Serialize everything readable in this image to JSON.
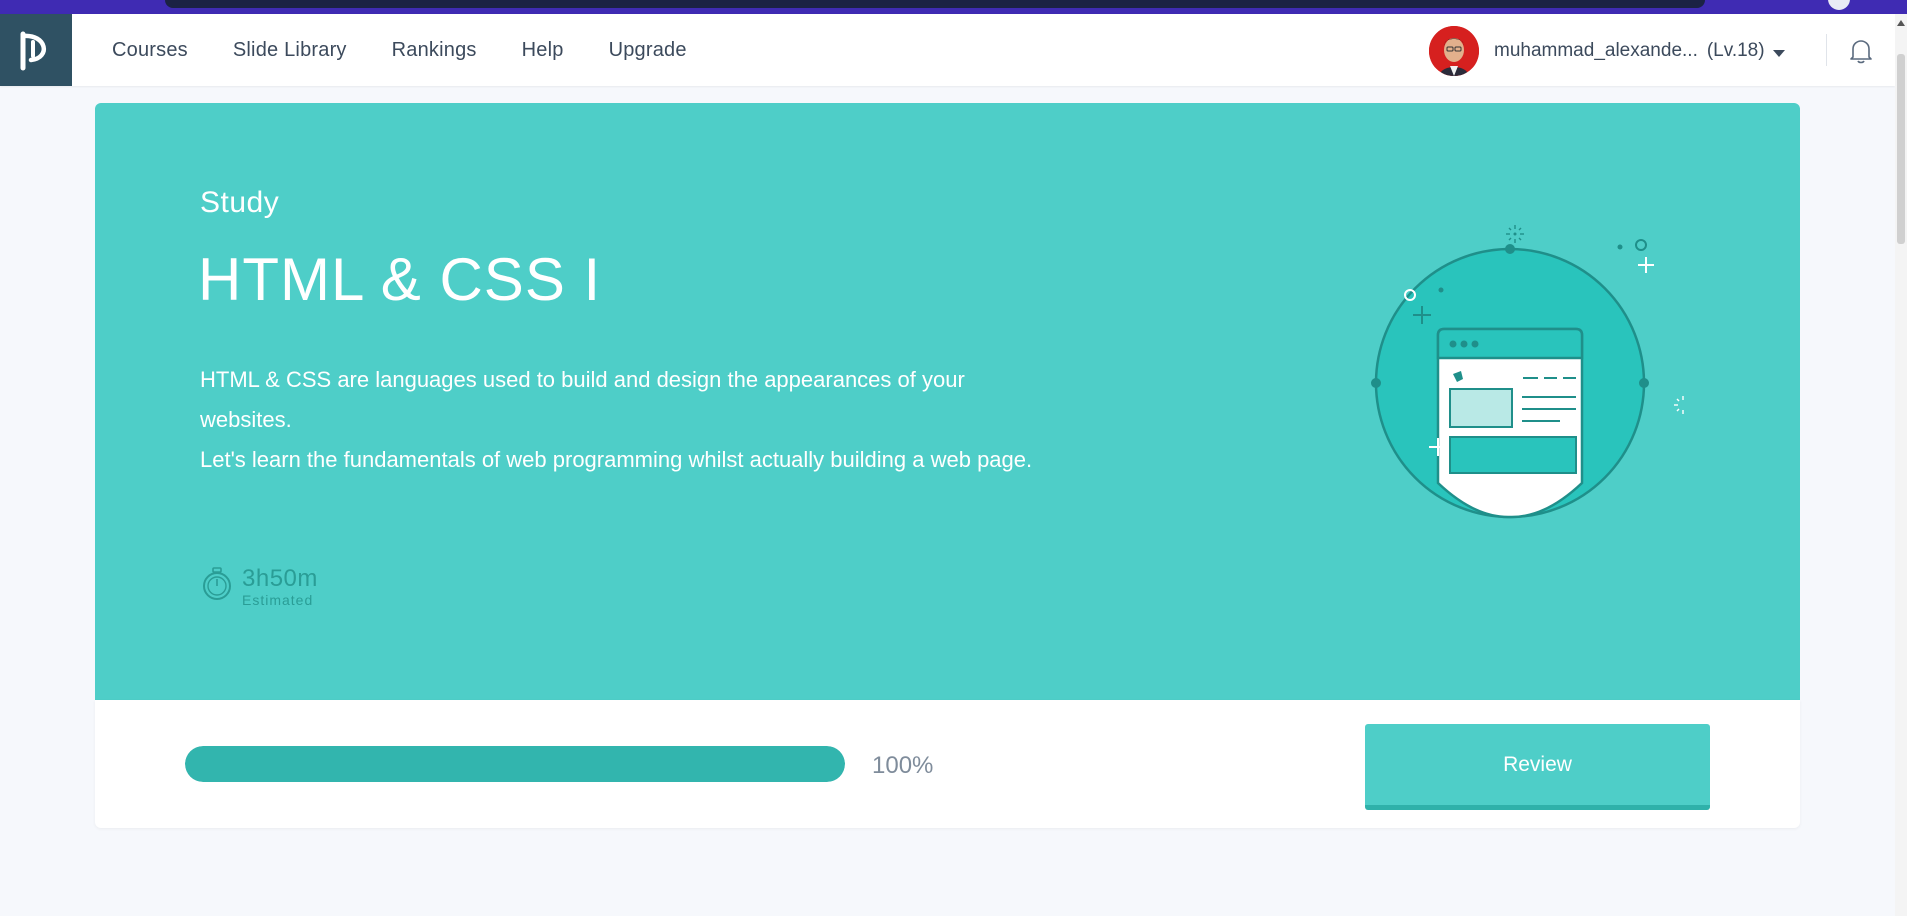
{
  "nav": {
    "links": [
      "Courses",
      "Slide Library",
      "Rankings",
      "Help",
      "Upgrade"
    ],
    "username": "muhammad_alexande...",
    "level": "(Lv.18)"
  },
  "hero": {
    "kicker": "Study",
    "title": "HTML & CSS I",
    "description_line1": "HTML & CSS are languages used to build and design the appearances of your websites.",
    "description_line2": "Let's learn the fundamentals of web programming whilst actually building a web page.",
    "time_value": "3h50m",
    "time_label": "Estimated"
  },
  "progress": {
    "percent": 100,
    "percent_label": "100%",
    "button_label": "Review"
  },
  "colors": {
    "nav_strip": "#3f2bb3",
    "hero_bg": "#4ecec8",
    "progress_fill": "#32b5ae",
    "logo_bg": "#2f5163"
  },
  "icons": [
    "logo-icon",
    "caret-down-icon",
    "bell-icon",
    "stopwatch-icon",
    "browser-illustration"
  ]
}
